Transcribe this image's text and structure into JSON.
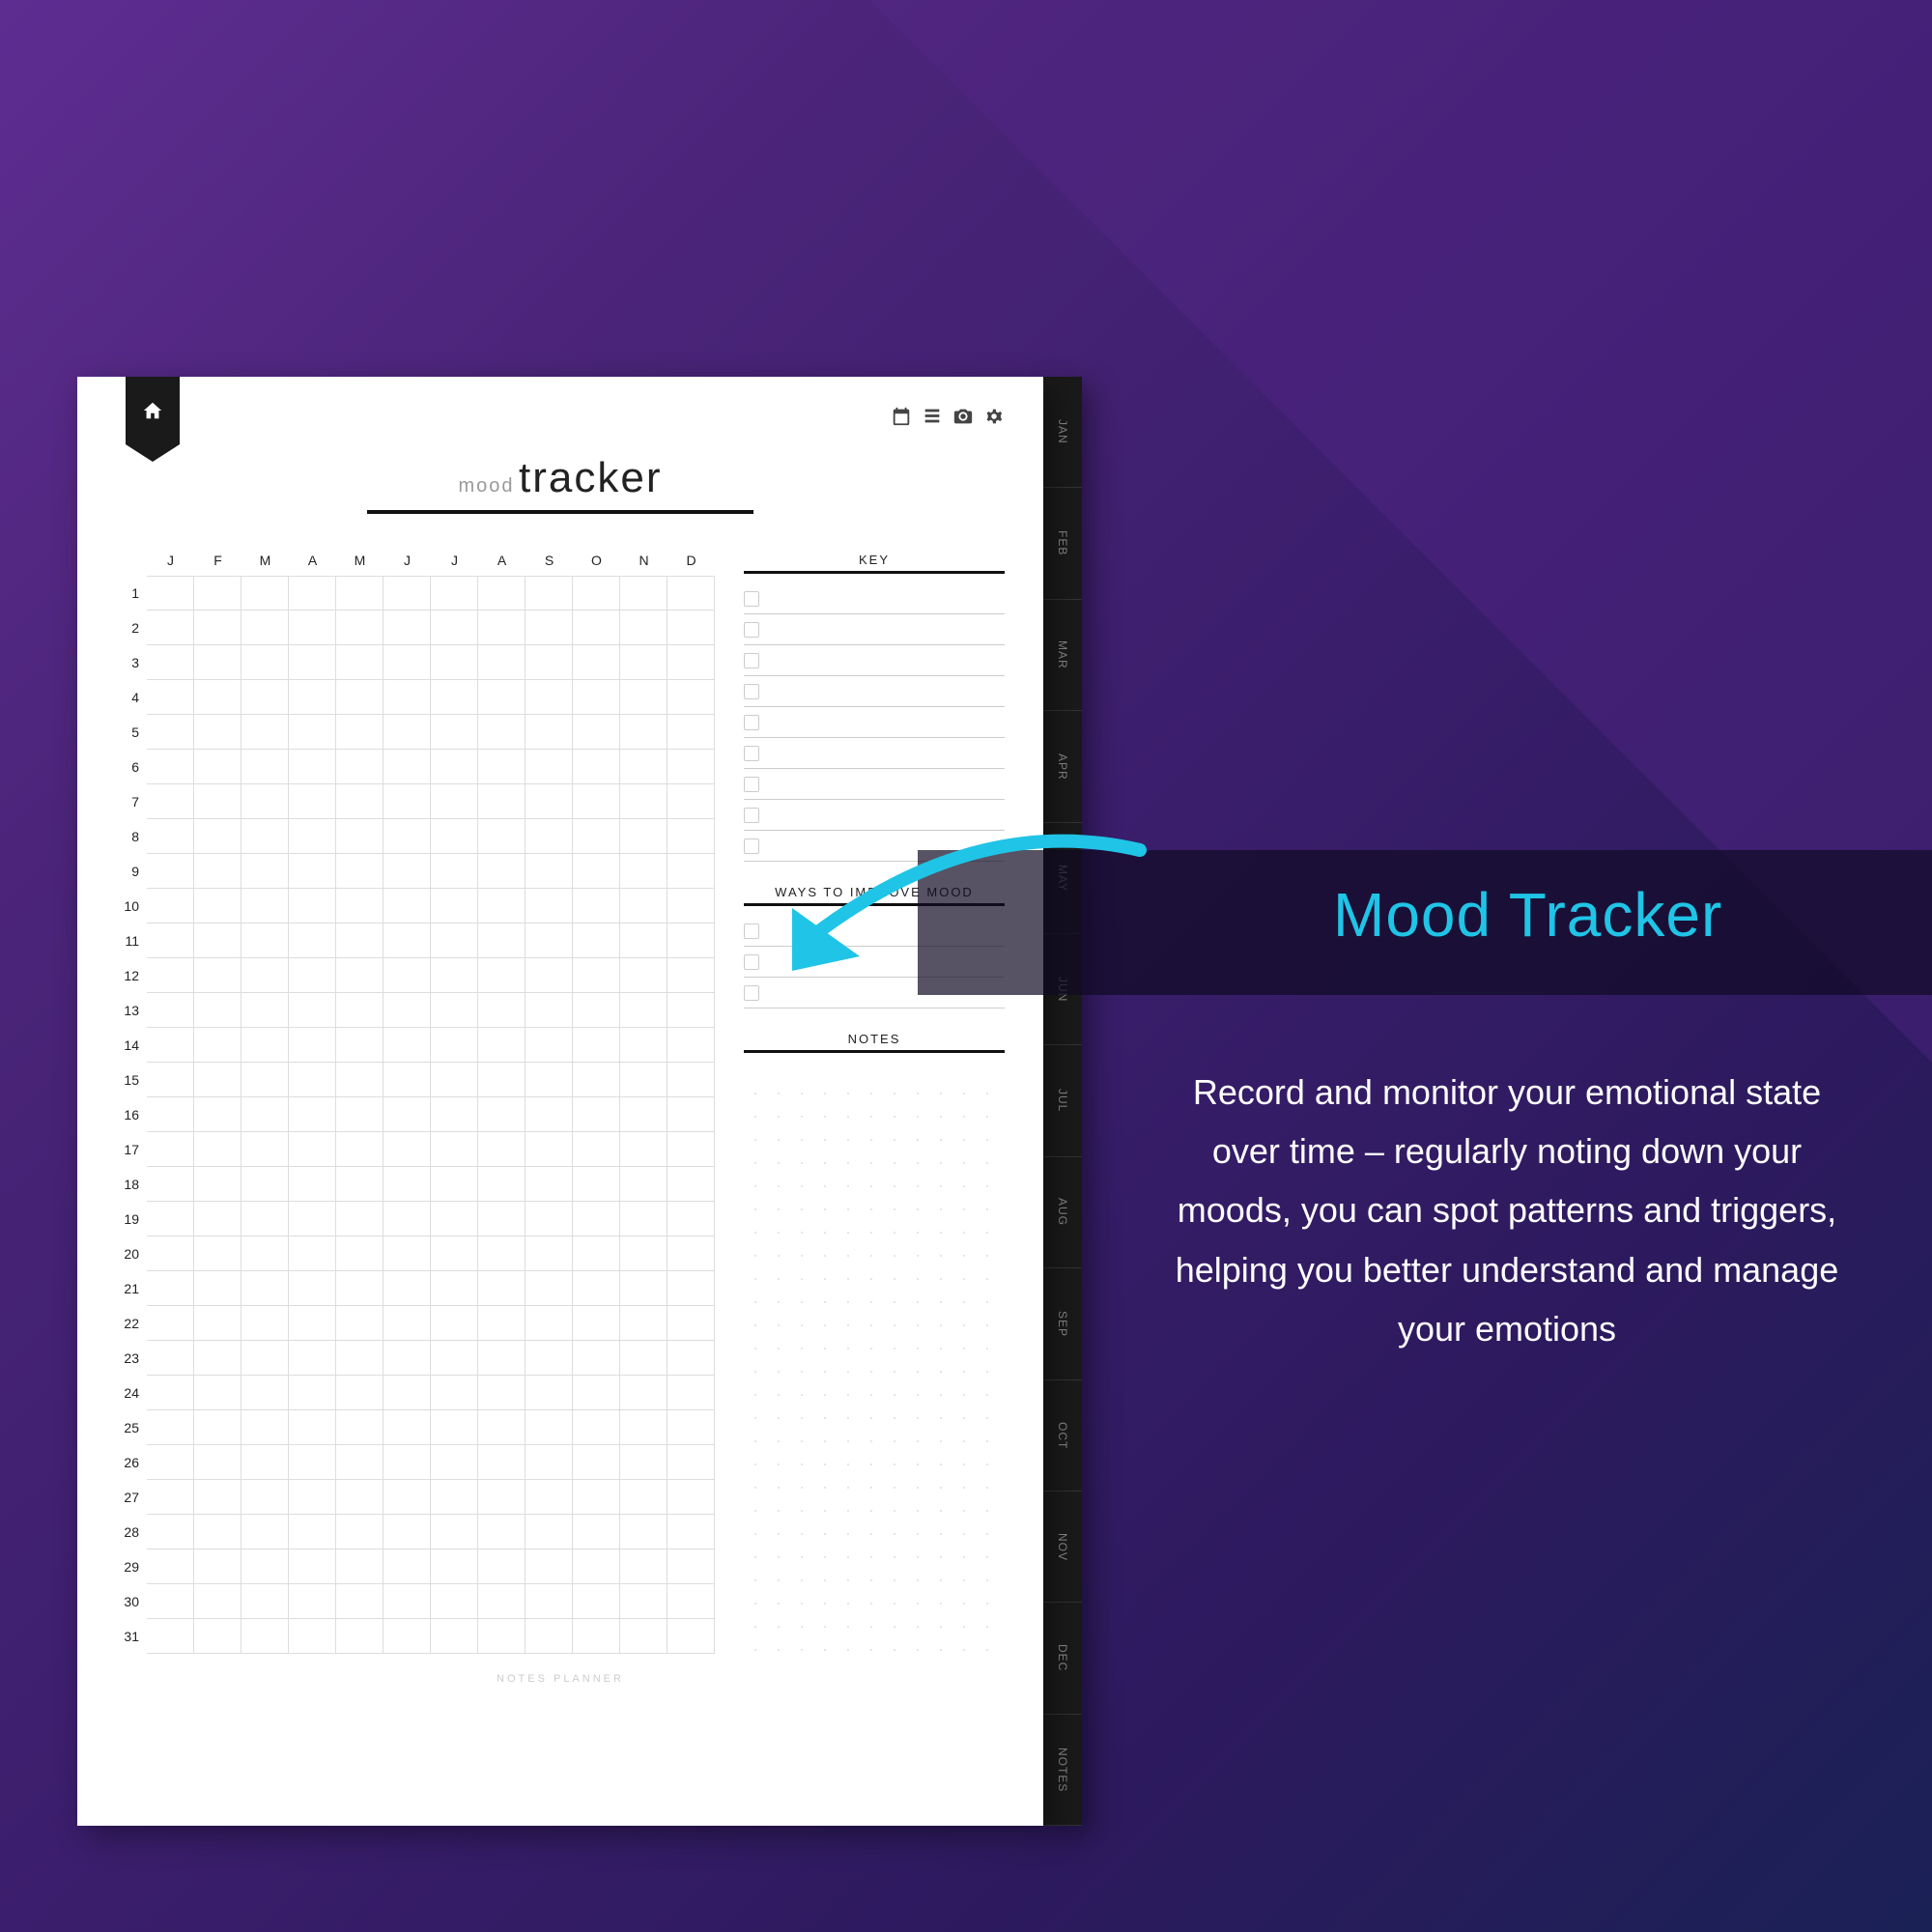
{
  "page": {
    "title_small": "mood",
    "title_large": "tracker",
    "months": [
      "J",
      "F",
      "M",
      "A",
      "M",
      "J",
      "J",
      "A",
      "S",
      "O",
      "N",
      "D"
    ],
    "days": [
      "1",
      "2",
      "3",
      "4",
      "5",
      "6",
      "7",
      "8",
      "9",
      "10",
      "11",
      "12",
      "13",
      "14",
      "15",
      "16",
      "17",
      "18",
      "19",
      "20",
      "21",
      "22",
      "23",
      "24",
      "25",
      "26",
      "27",
      "28",
      "29",
      "30",
      "31"
    ],
    "key_heading": "KEY",
    "ways_heading": "WAYS TO IMPROVE MOOD",
    "notes_heading": "NOTES",
    "key_rows": 9,
    "ways_rows": 3,
    "footer": "NOTES PLANNER"
  },
  "tabs": [
    "JAN",
    "FEB",
    "MAR",
    "APR",
    "MAY",
    "JUN",
    "JUL",
    "AUG",
    "SEP",
    "OCT",
    "NOV",
    "DEC",
    "NOTES"
  ],
  "callout": {
    "title": "Mood Tracker",
    "body": "Record and monitor your emotional state over time – regularly noting down your moods, you can spot patterns and triggers,  helping you better understand and manage your emotions"
  }
}
